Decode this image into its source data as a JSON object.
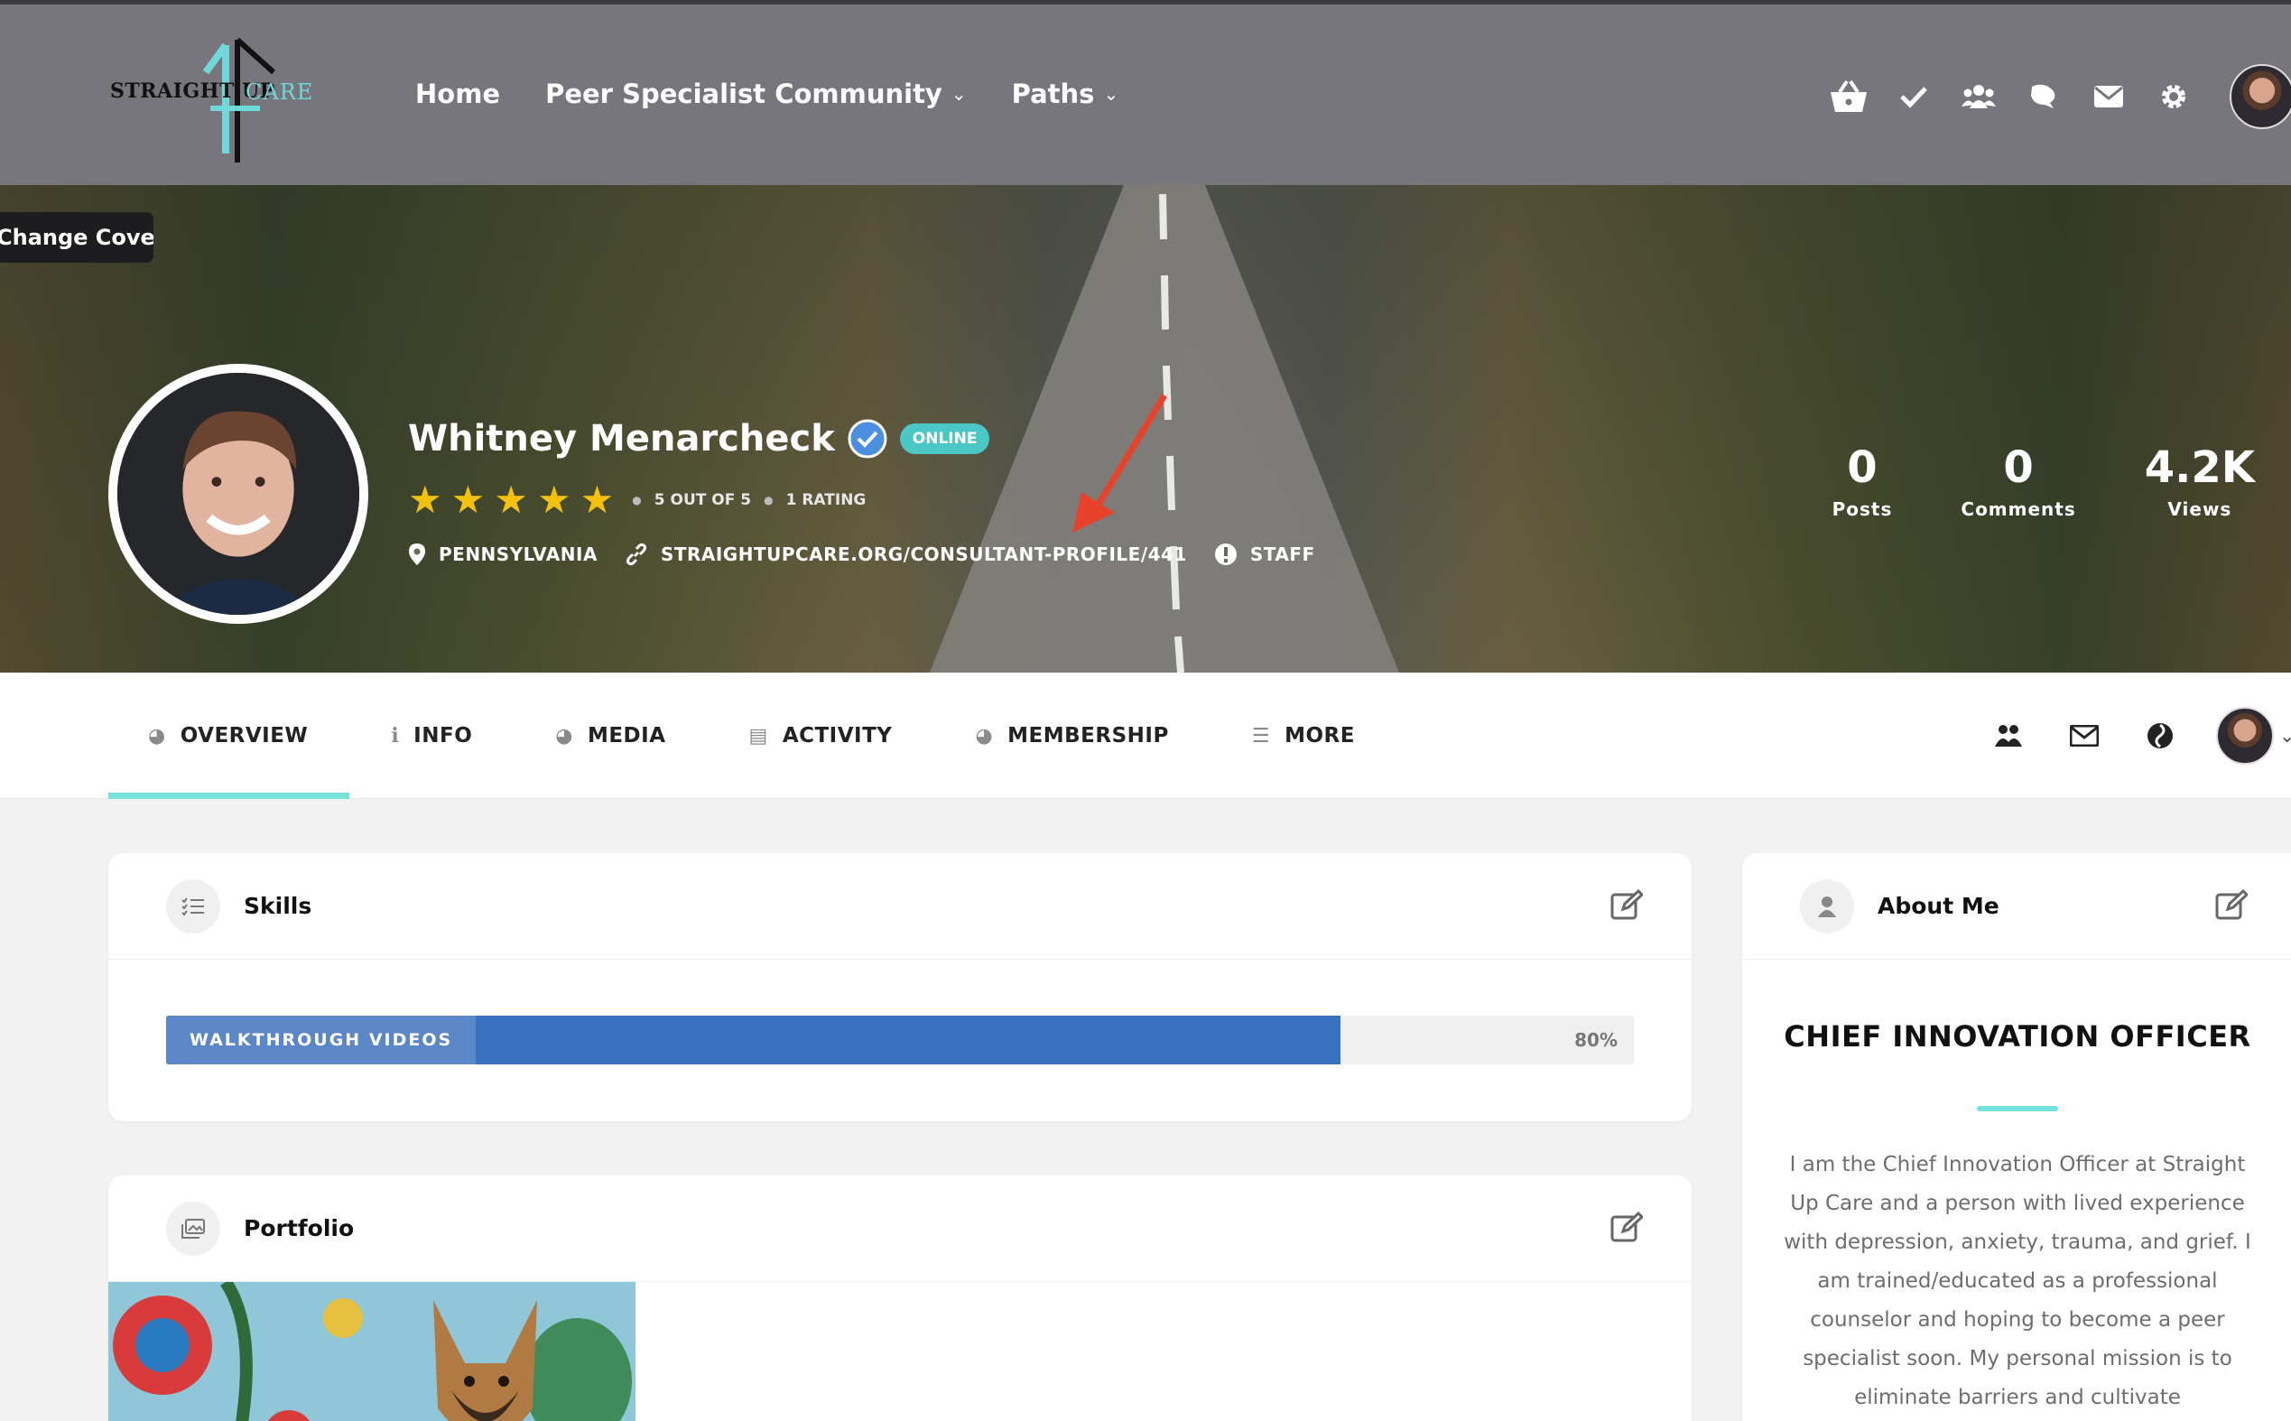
{
  "header": {
    "logo_text_left": "STRAIGHT UP",
    "logo_text_right": "CARE",
    "nav": [
      {
        "label": "Home",
        "has_dropdown": false
      },
      {
        "label": "Peer Specialist Community",
        "has_dropdown": true
      },
      {
        "label": "Paths",
        "has_dropdown": true
      }
    ],
    "icons": [
      "basket-icon",
      "check-icon",
      "groups-icon",
      "comments-icon",
      "mail-icon",
      "gear-icon",
      "user-avatar"
    ]
  },
  "cover": {
    "change_cover_label": "Change Cover",
    "name": "Whitney Menarcheck",
    "status_badge": "ONLINE",
    "stars": 5,
    "rating_text": "5 OUT OF 5",
    "rating_count": "1 RATING",
    "location": "PENNSYLVANIA",
    "profile_url": "STRAIGHTUPCARE.ORG/CONSULTANT-PROFILE/441",
    "role": "STAFF",
    "stats": [
      {
        "num": "0",
        "label": "Posts"
      },
      {
        "num": "0",
        "label": "Comments"
      },
      {
        "num": "4.2K",
        "label": "Views"
      }
    ]
  },
  "tabs": [
    {
      "label": "OVERVIEW",
      "icon": "globe-icon",
      "active": true
    },
    {
      "label": "INFO",
      "icon": "info-icon",
      "active": false
    },
    {
      "label": "MEDIA",
      "icon": "globe-icon",
      "active": false
    },
    {
      "label": "ACTIVITY",
      "icon": "id-card-icon",
      "active": false
    },
    {
      "label": "MEMBERSHIP",
      "icon": "globe-icon",
      "active": false
    },
    {
      "label": "MORE",
      "icon": "menu-icon",
      "active": false
    }
  ],
  "skills": {
    "title": "Skills",
    "items": [
      {
        "label": "WALKTHROUGH VIDEOS",
        "percent": 80,
        "percent_label": "80%"
      }
    ]
  },
  "portfolio": {
    "title": "Portfolio"
  },
  "about": {
    "title": "About Me",
    "heading": "CHIEF INNOVATION OFFICER",
    "text": "I am the Chief Innovation Officer at Straight Up Care and a person with lived experience with depression, anxiety, trauma, and grief. I am trained/educated as a professional counselor and hoping to become a peer specialist soon. My personal mission is to eliminate barriers and cultivate"
  },
  "colors": {
    "accent": "#73e3dc",
    "header_bg": "#76767c",
    "skill_bar": "#3a72c1",
    "star": "#f4c20d",
    "online": "#4bc8c6"
  }
}
